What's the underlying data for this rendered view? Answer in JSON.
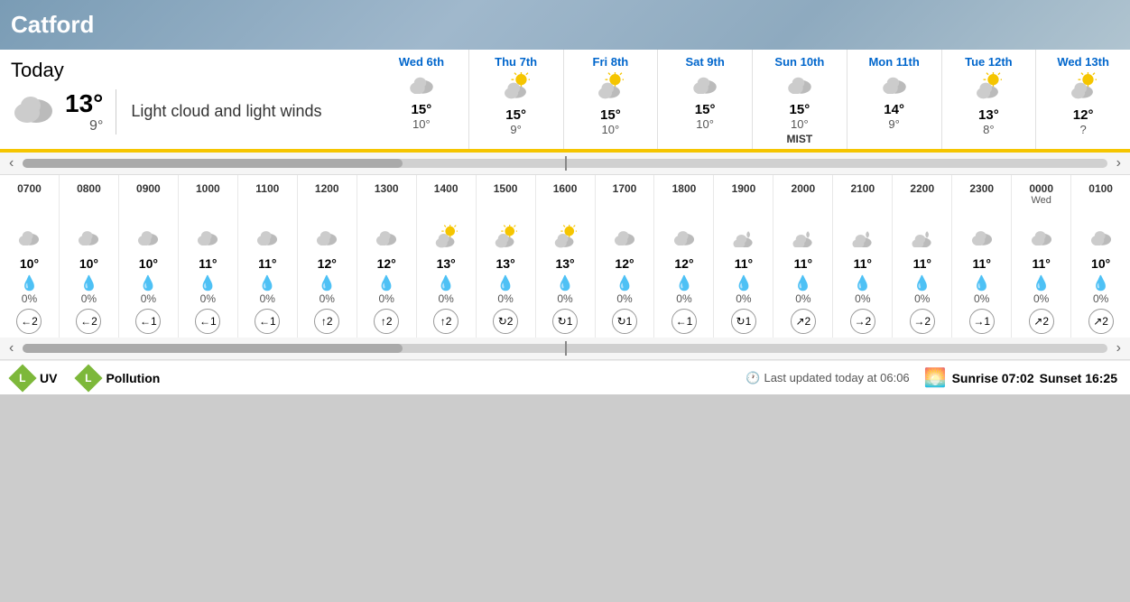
{
  "location": "Catford",
  "today": {
    "label": "Today",
    "high": "13°",
    "low": "9°",
    "description": "Light cloud and light winds",
    "icon": "cloud"
  },
  "forecast": [
    {
      "date": "Wed 6th",
      "high": "15°",
      "low": "10°",
      "icon": "cloud",
      "mist": false
    },
    {
      "date": "Thu 7th",
      "high": "15°",
      "low": "9°",
      "icon": "cloud-sun",
      "mist": false
    },
    {
      "date": "Fri 8th",
      "high": "15°",
      "low": "10°",
      "icon": "cloud-sun",
      "mist": false
    },
    {
      "date": "Sat 9th",
      "high": "15°",
      "low": "10°",
      "icon": "cloud",
      "mist": false
    },
    {
      "date": "Sun 10th",
      "high": "15°",
      "low": "10°",
      "icon": "cloud",
      "mist": true
    },
    {
      "date": "Mon 11th",
      "high": "14°",
      "low": "9°",
      "icon": "cloud",
      "mist": false
    },
    {
      "date": "Tue 12th",
      "high": "13°",
      "low": "8°",
      "icon": "cloud-sun",
      "mist": false
    },
    {
      "date": "Wed 13th",
      "high": "12°",
      "low": "?",
      "icon": "cloud-sun",
      "mist": false
    }
  ],
  "hourly": [
    {
      "time": "0700",
      "sublabel": "",
      "icon": "cloud",
      "temp": "10°",
      "precip": "0%",
      "wind_speed": 2,
      "wind_dir": "←"
    },
    {
      "time": "0800",
      "sublabel": "",
      "icon": "cloud",
      "temp": "10°",
      "precip": "0%",
      "wind_speed": 2,
      "wind_dir": "←"
    },
    {
      "time": "0900",
      "sublabel": "",
      "icon": "cloud",
      "temp": "10°",
      "precip": "0%",
      "wind_speed": 1,
      "wind_dir": "←"
    },
    {
      "time": "1000",
      "sublabel": "",
      "icon": "cloud",
      "temp": "11°",
      "precip": "0%",
      "wind_speed": 1,
      "wind_dir": "←"
    },
    {
      "time": "1100",
      "sublabel": "",
      "icon": "cloud",
      "temp": "11°",
      "precip": "0%",
      "wind_speed": 1,
      "wind_dir": "←"
    },
    {
      "time": "1200",
      "sublabel": "",
      "icon": "cloud",
      "temp": "12°",
      "precip": "0%",
      "wind_speed": 2,
      "wind_dir": "↑"
    },
    {
      "time": "1300",
      "sublabel": "",
      "icon": "cloud",
      "temp": "12°",
      "precip": "0%",
      "wind_speed": 2,
      "wind_dir": "↑"
    },
    {
      "time": "1400",
      "sublabel": "",
      "icon": "cloud-sun",
      "temp": "13°",
      "precip": "0%",
      "wind_speed": 2,
      "wind_dir": "↑"
    },
    {
      "time": "1500",
      "sublabel": "",
      "icon": "cloud-sun",
      "temp": "13°",
      "precip": "0%",
      "wind_speed": 2,
      "wind_dir": "↻"
    },
    {
      "time": "1600",
      "sublabel": "",
      "icon": "cloud-sun",
      "temp": "13°",
      "precip": "0%",
      "wind_speed": 1,
      "wind_dir": "↻"
    },
    {
      "time": "1700",
      "sublabel": "",
      "icon": "cloud",
      "temp": "12°",
      "precip": "0%",
      "wind_speed": 1,
      "wind_dir": "↻"
    },
    {
      "time": "1800",
      "sublabel": "",
      "icon": "cloud",
      "temp": "12°",
      "precip": "0%",
      "wind_speed": 1,
      "wind_dir": "←"
    },
    {
      "time": "1900",
      "sublabel": "",
      "icon": "cloud-night",
      "temp": "11°",
      "precip": "0%",
      "wind_speed": 1,
      "wind_dir": "↻"
    },
    {
      "time": "2000",
      "sublabel": "",
      "icon": "cloud-night",
      "temp": "11°",
      "precip": "0%",
      "wind_speed": 2,
      "wind_dir": "↗"
    },
    {
      "time": "2100",
      "sublabel": "",
      "icon": "cloud-night",
      "temp": "11°",
      "precip": "0%",
      "wind_speed": 2,
      "wind_dir": "→"
    },
    {
      "time": "2200",
      "sublabel": "",
      "icon": "cloud-night",
      "temp": "11°",
      "precip": "0%",
      "wind_speed": 2,
      "wind_dir": "→"
    },
    {
      "time": "2300",
      "sublabel": "",
      "icon": "cloud",
      "temp": "11°",
      "precip": "0%",
      "wind_speed": 1,
      "wind_dir": "→"
    },
    {
      "time": "0000",
      "sublabel": "Wed",
      "icon": "cloud",
      "temp": "11°",
      "precip": "0%",
      "wind_speed": 2,
      "wind_dir": "↗"
    },
    {
      "time": "0100",
      "sublabel": "",
      "icon": "cloud",
      "temp": "10°",
      "precip": "0%",
      "wind_speed": 2,
      "wind_dir": "↗"
    }
  ],
  "last_updated": "Last updated today at 06:06",
  "sunrise": "Sunrise 07:02",
  "sunset": "Sunset 16:25",
  "uv_label": "UV",
  "uv_level": "L",
  "pollution_label": "Pollution",
  "pollution_level": "L"
}
